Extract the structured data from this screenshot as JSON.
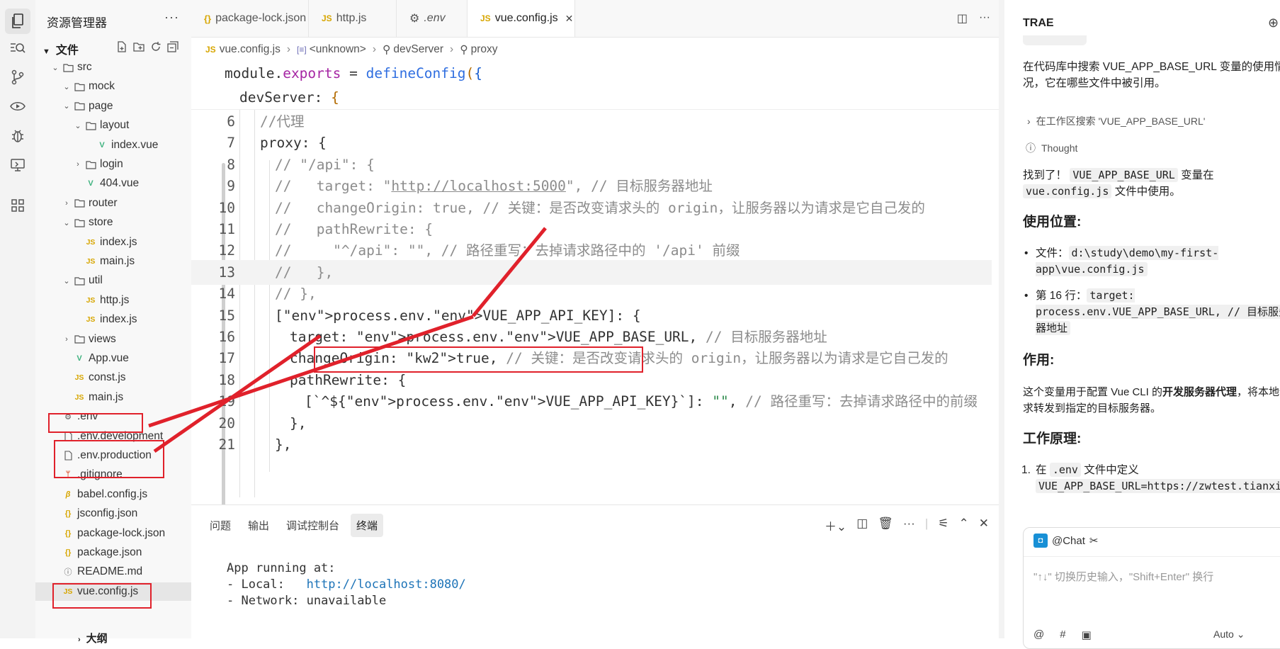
{
  "explorer": {
    "title": "资源管理器",
    "more": "···",
    "section": "文件",
    "items": [
      {
        "label": "src",
        "indent": 1,
        "type": "folder",
        "open": true
      },
      {
        "label": "mock",
        "indent": 2,
        "type": "folder",
        "open": true
      },
      {
        "label": "page",
        "indent": 2,
        "type": "folder",
        "open": true
      },
      {
        "label": "layout",
        "indent": 3,
        "type": "folder",
        "open": true
      },
      {
        "label": "index.vue",
        "indent": 4,
        "type": "vue"
      },
      {
        "label": "login",
        "indent": 3,
        "type": "folder",
        "open": false
      },
      {
        "label": "404.vue",
        "indent": 3,
        "type": "vue"
      },
      {
        "label": "router",
        "indent": 2,
        "type": "folder",
        "open": false
      },
      {
        "label": "store",
        "indent": 2,
        "type": "folder",
        "open": true
      },
      {
        "label": "index.js",
        "indent": 3,
        "type": "js"
      },
      {
        "label": "main.js",
        "indent": 3,
        "type": "js"
      },
      {
        "label": "util",
        "indent": 2,
        "type": "folder",
        "open": true
      },
      {
        "label": "http.js",
        "indent": 3,
        "type": "js"
      },
      {
        "label": "index.js",
        "indent": 3,
        "type": "js"
      },
      {
        "label": "views",
        "indent": 2,
        "type": "folder",
        "open": false
      },
      {
        "label": "App.vue",
        "indent": 2,
        "type": "vue"
      },
      {
        "label": "const.js",
        "indent": 2,
        "type": "js"
      },
      {
        "label": "main.js",
        "indent": 2,
        "type": "js"
      },
      {
        "label": ".env",
        "indent": 1,
        "type": "gear"
      },
      {
        "label": ".env.development",
        "indent": 1,
        "type": "file"
      },
      {
        "label": ".env.production",
        "indent": 1,
        "type": "file"
      },
      {
        "label": ".gitignore",
        "indent": 1,
        "type": "git"
      },
      {
        "label": "babel.config.js",
        "indent": 1,
        "type": "babel"
      },
      {
        "label": "jsconfig.json",
        "indent": 1,
        "type": "json"
      },
      {
        "label": "package-lock.json",
        "indent": 1,
        "type": "json"
      },
      {
        "label": "package.json",
        "indent": 1,
        "type": "json"
      },
      {
        "label": "README.md",
        "indent": 1,
        "type": "info"
      },
      {
        "label": "vue.config.js",
        "indent": 1,
        "type": "js",
        "selected": true
      }
    ],
    "outline": "大纲"
  },
  "tabs": [
    {
      "label": "package-lock.json",
      "icon": "{}"
    },
    {
      "label": "http.js",
      "icon": "JS"
    },
    {
      "label": ".env",
      "icon": "gear"
    },
    {
      "label": "vue.config.js",
      "icon": "JS",
      "active": true
    }
  ],
  "breadcrumb": [
    "vue.config.js",
    "<unknown>",
    "devServer",
    "proxy"
  ],
  "code": {
    "sticky1": "module.exports = defineConfig({",
    "sticky2": "devServer: {",
    "lines": [
      {
        "n": "6",
        "text": "//代理"
      },
      {
        "n": "7",
        "text": "proxy: {"
      },
      {
        "n": "8",
        "text": "// \"/api\": {"
      },
      {
        "n": "9",
        "text": "//   target: \"http://localhost:5000\", // 目标服务器地址"
      },
      {
        "n": "10",
        "text": "//   changeOrigin: true, // 关键：是否改变请求头的 origin，让服务器以为请求是它自己发的"
      },
      {
        "n": "11",
        "text": "//   pathRewrite: {"
      },
      {
        "n": "12",
        "text": "//     \"^/api\": \"\", // 路径重写：去掉请求路径中的 '/api' 前缀"
      },
      {
        "n": "13",
        "text": "//   },"
      },
      {
        "n": "14",
        "text": "// },"
      },
      {
        "n": "15",
        "text": "[process.env.VUE_APP_API_KEY]: {"
      },
      {
        "n": "16",
        "text": "target: process.env.VUE_APP_BASE_URL, // 目标服务器地址"
      },
      {
        "n": "17",
        "text": "changeOrigin: true, // 关键：是否改变请求头的 origin，让服务器以为请求是它自己发的"
      },
      {
        "n": "18",
        "text": "pathRewrite: {"
      },
      {
        "n": "19",
        "text": "[`^${process.env.VUE_APP_API_KEY}`]: \"\", // 路径重写：去掉请求路径中的前缀"
      },
      {
        "n": "20",
        "text": "},"
      },
      {
        "n": "21",
        "text": "},"
      }
    ]
  },
  "panel": {
    "tabs": [
      "问题",
      "输出",
      "调试控制台",
      "终端"
    ],
    "active_tab": "终端",
    "terminal": {
      "line1": "App running at:",
      "local_label": "- Local:   ",
      "local_url": "http://localhost:8080/",
      "network_label": "- Network: ",
      "network_value": "unavailable"
    }
  },
  "chat": {
    "title": "TRAE",
    "intro": "在代码库中搜索 VUE_APP_BASE_URL 变量的使用情况，它在哪些文件中被引用。",
    "search_step": "在工作区搜索 'VUE_APP_BASE_URL'",
    "thought": "Thought",
    "found_prefix": "找到了！",
    "found_var": "VUE_APP_BASE_URL",
    "found_mid": "变量在",
    "found_file": "vue.config.js",
    "found_suffix": "文件中使用。",
    "usage_heading": "使用位置:",
    "usage_file_label": "文件：",
    "usage_file": "d:\\study\\demo\\my-first-app\\vue.config.js",
    "usage_line_label": "第 16 行：",
    "usage_line": "target: process.env.VUE_APP_BASE_URL, // 目标服务器地址",
    "purpose_heading": "作用:",
    "purpose_text_1": "这个变量用于配置 Vue CLI 的",
    "purpose_bold": "开发服务器代理",
    "purpose_text_2": "，将本地请求转发到指定的目标服务器。",
    "principle_heading": "工作原理:",
    "step1_prefix": "在",
    "step1_file": ".env",
    "step1_mid": "文件中定义",
    "step1_code": "VUE_APP_BASE_URL=https://zwtest.tianxiang.com/",
    "chip_label": "@Chat",
    "input_placeholder": "\"↑↓\" 切换历史输入，\"Shift+Enter\" 换行",
    "model_label": "Auto"
  },
  "colors": {
    "annotation": "#e0212b",
    "vue_green": "#3fb27f",
    "js_yellow": "#d7a600"
  }
}
